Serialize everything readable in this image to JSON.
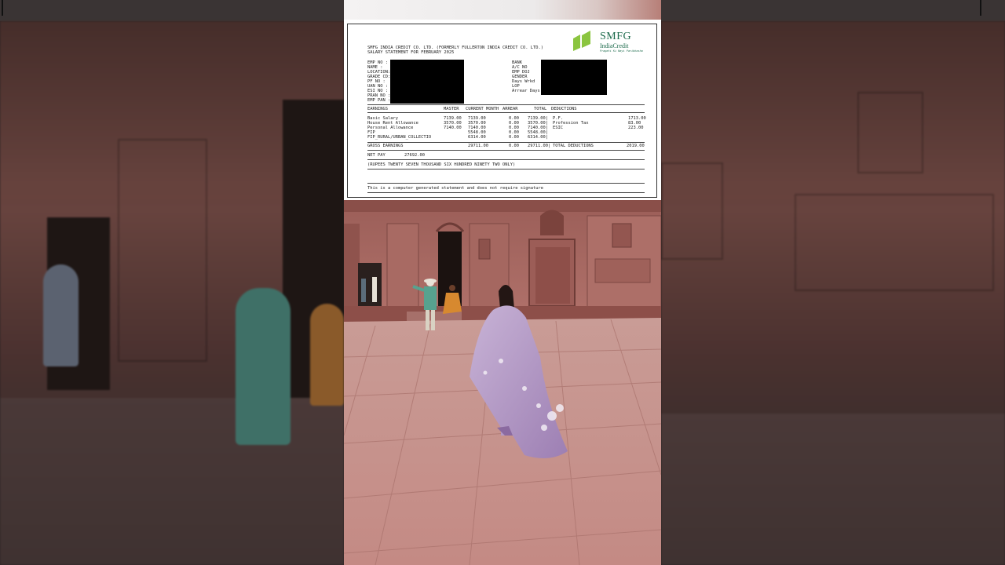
{
  "document": {
    "company_line": "SMFG INDIA CREDIT  CO. LTD. (FORMERLY FULLERTON INDIA CREDIT CO. LTD.)",
    "statement_title": "SALARY STATEMENT FOR FEBRUARY 2025",
    "logo": {
      "brand": "SMFG",
      "brand_sub": "IndiaCredit",
      "tagline": "Pragati Ki Nayi Paribhasha",
      "color": "#1d6b4c",
      "accent": "#8bc53f"
    },
    "left_fields": [
      "EMP NO  :",
      "NAME    :",
      "LOCATION:",
      "GRADE CD:",
      "PF NO   :",
      "UAN NO  :",
      "ESI NO  :",
      "PRAN NO :",
      "EMP PAN :"
    ],
    "right_fields": [
      "BANK",
      "A/C NO",
      "EMP DOJ",
      "GENDER",
      "Days Wrkd",
      "LOP",
      "Arrear Days"
    ],
    "table_headers": [
      "EARNINGS",
      "MASTER",
      "CURRENT MONTH",
      "ARREAR",
      "TOTAL",
      "DEDUCTIONS"
    ],
    "earnings": [
      {
        "name": "Basic Salary",
        "master": "7139.00",
        "current": "7139.00",
        "arrear": "0.00",
        "total": "7139.00|",
        "ded_name": "P.F.",
        "ded_amt": "1713.00"
      },
      {
        "name": "House Rent Allowance",
        "master": "3570.00",
        "current": "3570.00",
        "arrear": "0.00",
        "total": "3570.00|",
        "ded_name": "Profession Tax",
        "ded_amt": "83.00"
      },
      {
        "name": "Personal Allowance",
        "master": "7140.00",
        "current": "7140.00",
        "arrear": "0.00",
        "total": "7140.00|",
        "ded_name": "ESIC",
        "ded_amt": "223.00"
      },
      {
        "name": "FIP",
        "master": "",
        "current": "5548.00",
        "arrear": "0.00",
        "total": "5548.00|",
        "ded_name": "",
        "ded_amt": ""
      },
      {
        "name": "FIP_RURAL/URBAN_COLLECTIO",
        "master": "",
        "current": "6314.00",
        "arrear": "0.00",
        "total": "6314.00|",
        "ded_name": "",
        "ded_amt": ""
      }
    ],
    "gross": {
      "label": "GROSS EARNINGS",
      "current": "29711.00",
      "arrear": "0.00",
      "total": "29711.00|",
      "ded_label": "TOTAL DEDUCTIONS",
      "ded_amt": "2019.00"
    },
    "net_pay": {
      "label": "NET PAY",
      "value": "27692.00"
    },
    "amount_words": "(RUPEES TWENTY SEVEN THOUSAND SIX HUNDRED NINETY TWO ONLY)",
    "footer_note": "This is a computer generated statement and does not require signature"
  },
  "colors": {
    "sandstone": "#b98883",
    "saree": "#b59ac7",
    "redaction": "#000000"
  }
}
